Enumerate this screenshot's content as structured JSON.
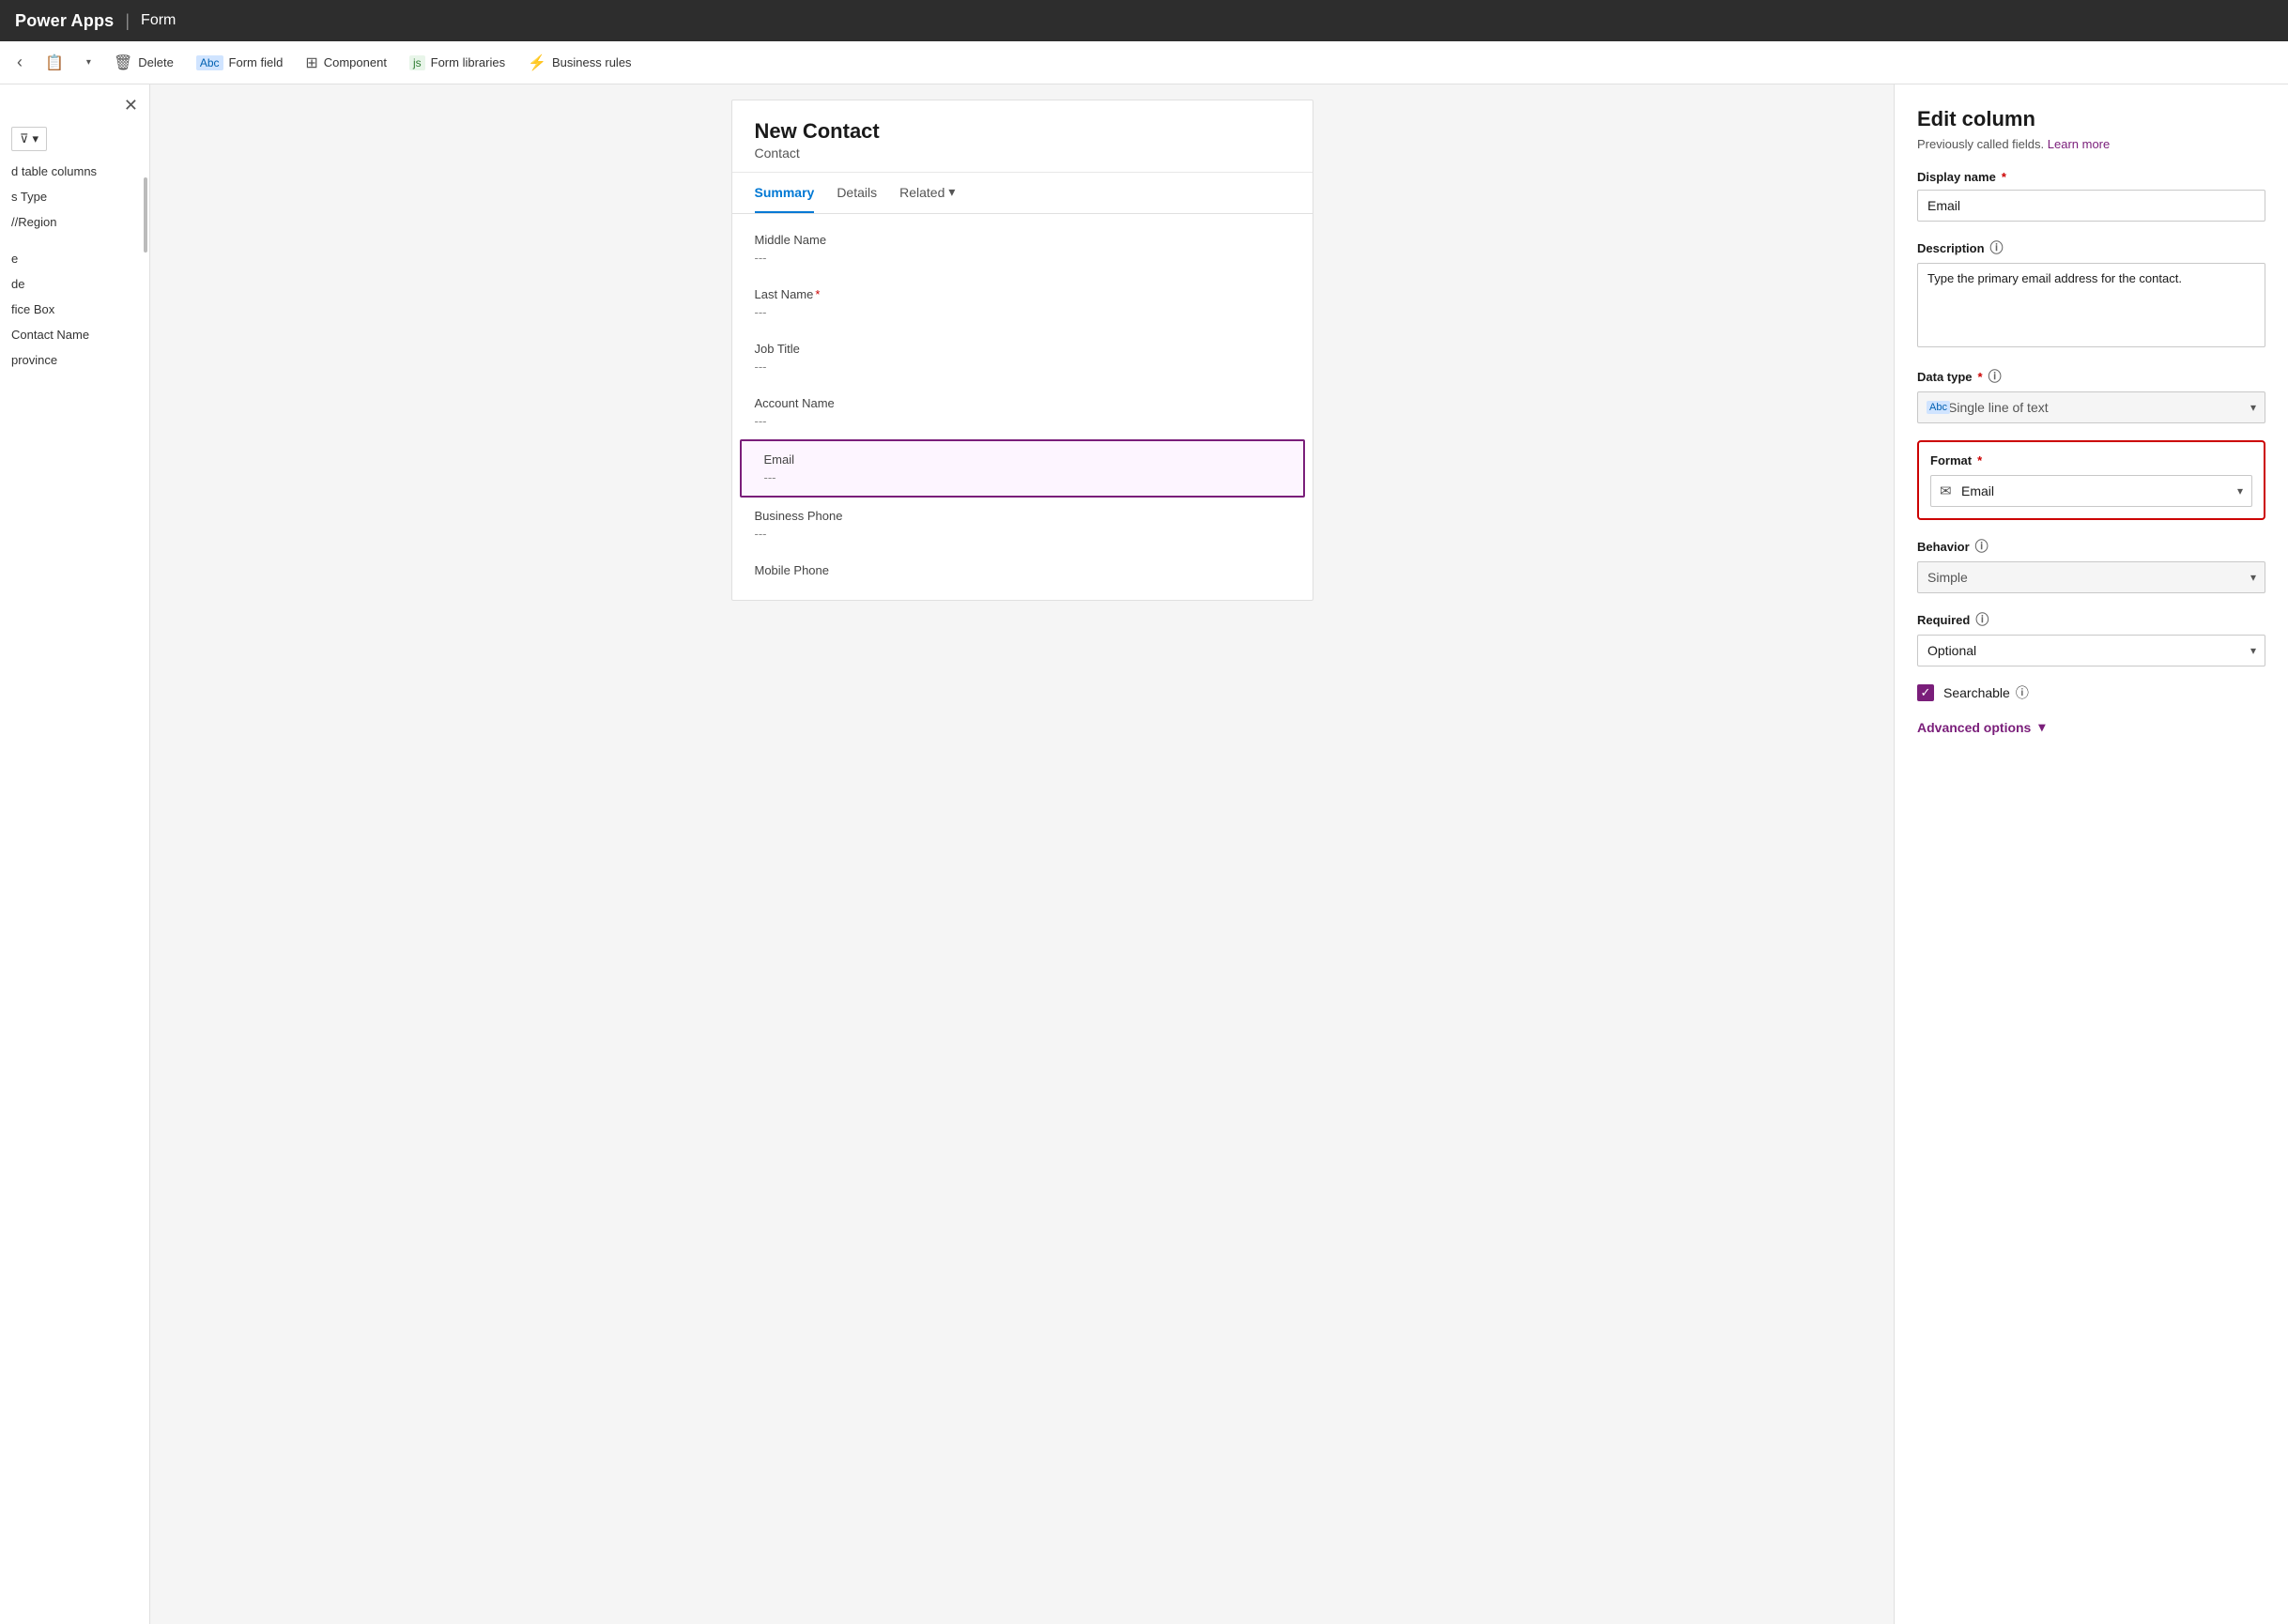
{
  "topbar": {
    "app_name": "Power Apps",
    "separator": "|",
    "section": "Form"
  },
  "ribbon": {
    "buttons": [
      {
        "id": "delete",
        "label": "Delete",
        "icon": "🗑"
      },
      {
        "id": "form-field",
        "label": "Form field",
        "icon": "Abc"
      },
      {
        "id": "component",
        "label": "Component",
        "icon": "⊞"
      },
      {
        "id": "form-libraries",
        "label": "Form libraries",
        "icon": "js"
      },
      {
        "id": "business-rules",
        "label": "Business rules",
        "icon": "⚡"
      }
    ],
    "dropdown_icon": "▾"
  },
  "sidebar": {
    "filter_label": "▼",
    "items": [
      {
        "label": "d table columns"
      },
      {
        "label": "s Type"
      },
      {
        "label": "//Region"
      },
      {
        "label": ""
      },
      {
        "label": "e"
      },
      {
        "label": "de"
      },
      {
        "label": "fice Box"
      },
      {
        "label": "Contact Name"
      },
      {
        "label": "province"
      }
    ]
  },
  "form": {
    "header_title": "New Contact",
    "header_sub": "Contact",
    "tabs": [
      {
        "id": "summary",
        "label": "Summary",
        "active": true
      },
      {
        "id": "details",
        "label": "Details",
        "active": false
      },
      {
        "id": "related",
        "label": "Related",
        "active": false,
        "has_chevron": true
      }
    ],
    "fields": [
      {
        "id": "middle-name",
        "label": "Middle Name",
        "value": "---",
        "required": false,
        "selected": false
      },
      {
        "id": "last-name",
        "label": "Last Name",
        "value": "---",
        "required": true,
        "selected": false
      },
      {
        "id": "job-title",
        "label": "Job Title",
        "value": "---",
        "required": false,
        "selected": false
      },
      {
        "id": "account-name",
        "label": "Account Name",
        "value": "---",
        "required": false,
        "selected": false
      },
      {
        "id": "email",
        "label": "Email",
        "value": "---",
        "required": false,
        "selected": true
      },
      {
        "id": "business-phone",
        "label": "Business Phone",
        "value": "---",
        "required": false,
        "selected": false
      },
      {
        "id": "mobile-phone",
        "label": "Mobile Phone",
        "value": "",
        "required": false,
        "selected": false
      }
    ]
  },
  "edit_column": {
    "title": "Edit column",
    "subtitle": "Previously called fields.",
    "learn_more": "Learn more",
    "display_name_label": "Display name",
    "display_name_required": true,
    "display_name_value": "Email",
    "description_label": "Description",
    "description_value": "Type the primary email address for the contact.",
    "data_type_label": "Data type",
    "data_type_required": true,
    "data_type_value": "Single line of text",
    "data_type_icon": "Abc",
    "format_label": "Format",
    "format_required": true,
    "format_value": "Email",
    "format_icon": "✉",
    "behavior_label": "Behavior",
    "behavior_value": "Simple",
    "required_label": "Required",
    "required_value": "Optional",
    "searchable_label": "Searchable",
    "searchable_checked": true,
    "advanced_options_label": "Advanced options",
    "chevron_down": "▾"
  }
}
